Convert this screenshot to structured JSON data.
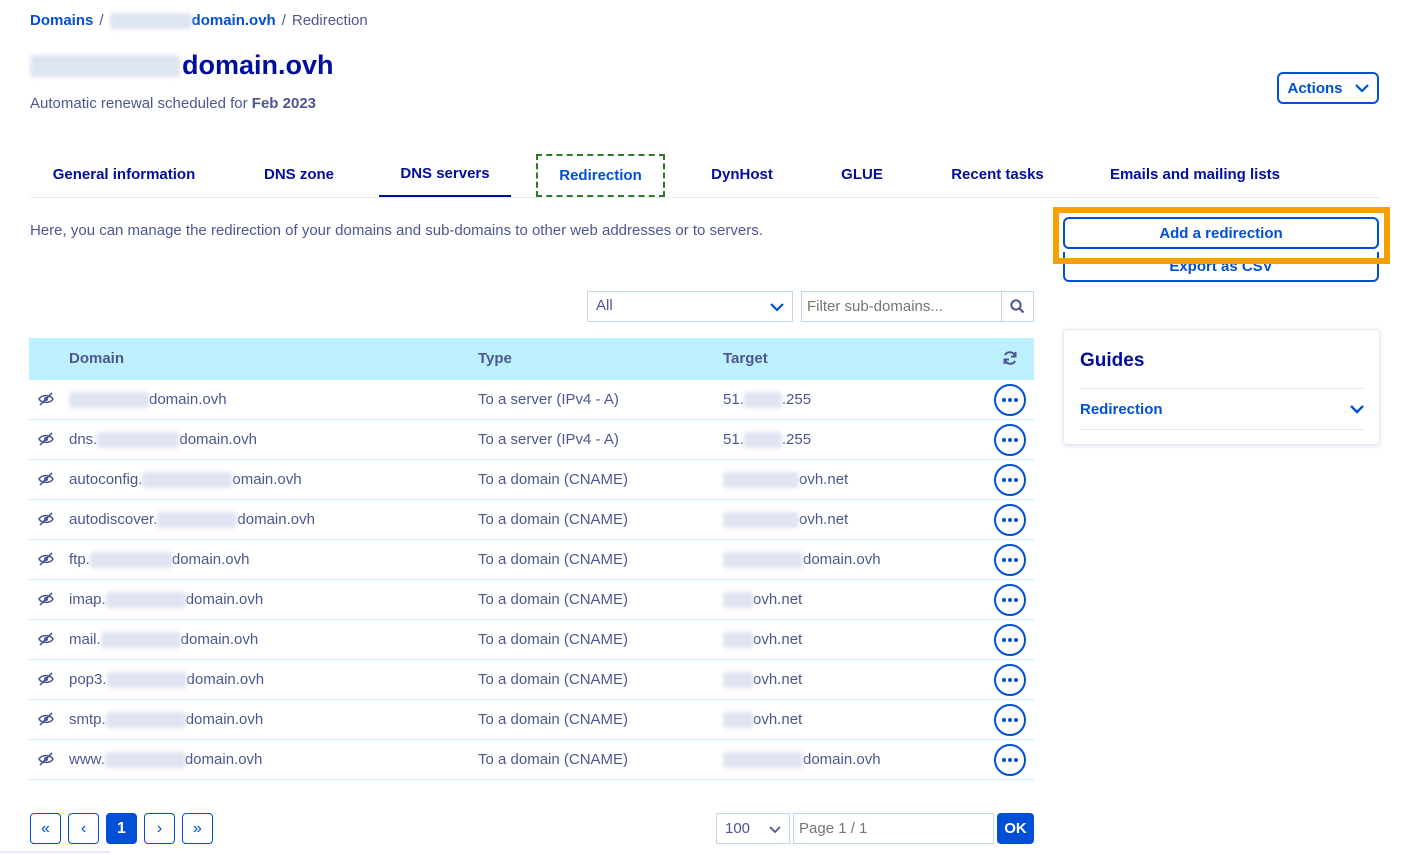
{
  "breadcrumb": {
    "root": "Domains",
    "sep1": "/",
    "domain": "domain.ovh",
    "sep2": "/",
    "current": "Redirection"
  },
  "header": {
    "title": "domain.ovh",
    "renewal_prefix": "Automatic renewal scheduled for ",
    "renewal_date": "Feb 2023",
    "actions_label": "Actions"
  },
  "tabs": [
    {
      "label": "General information"
    },
    {
      "label": "DNS zone"
    },
    {
      "label": "DNS servers"
    },
    {
      "label": "Redirection"
    },
    {
      "label": "DynHost"
    },
    {
      "label": "GLUE"
    },
    {
      "label": "Recent tasks"
    },
    {
      "label": "Emails and mailing lists"
    }
  ],
  "intro": "Here, you can manage the redirection of your domains and sub-domains to other web addresses or to servers.",
  "side": {
    "add_label": "Add a redirection",
    "export_label": "Export as CSV",
    "guides_title": "Guides",
    "guide_item": "Redirection"
  },
  "filters": {
    "type_value": "All",
    "search_placeholder": "Filter sub-domains..."
  },
  "table": {
    "headers": {
      "domain": "Domain",
      "type": "Type",
      "target": "Target"
    },
    "rows": [
      {
        "domain_prefix": "",
        "domain_suffix": "domain.ovh",
        "type": "To a server (IPv4 - A)",
        "target_prefix": "51.",
        "target_suffix": ".255"
      },
      {
        "domain_prefix": "dns.",
        "domain_suffix": "domain.ovh",
        "type": "To a server (IPv4 - A)",
        "target_prefix": "51.",
        "target_suffix": ".255"
      },
      {
        "domain_prefix": "autoconfig.",
        "domain_suffix": "omain.ovh",
        "type": "To a domain (CNAME)",
        "target_prefix": "",
        "target_suffix": "ovh.net"
      },
      {
        "domain_prefix": "autodiscover.",
        "domain_suffix": "domain.ovh",
        "type": "To a domain (CNAME)",
        "target_prefix": "",
        "target_suffix": "ovh.net"
      },
      {
        "domain_prefix": "ftp.",
        "domain_suffix": "domain.ovh",
        "type": "To a domain (CNAME)",
        "target_prefix": "",
        "target_suffix": "domain.ovh"
      },
      {
        "domain_prefix": "imap.",
        "domain_suffix": "domain.ovh",
        "type": "To a domain (CNAME)",
        "target_prefix": "",
        "target_suffix": "ovh.net"
      },
      {
        "domain_prefix": "mail.",
        "domain_suffix": "domain.ovh",
        "type": "To a domain (CNAME)",
        "target_prefix": "",
        "target_suffix": "ovh.net"
      },
      {
        "domain_prefix": "pop3.",
        "domain_suffix": "domain.ovh",
        "type": "To a domain (CNAME)",
        "target_prefix": "",
        "target_suffix": "ovh.net"
      },
      {
        "domain_prefix": "smtp.",
        "domain_suffix": "domain.ovh",
        "type": "To a domain (CNAME)",
        "target_prefix": "",
        "target_suffix": "ovh.net"
      },
      {
        "domain_prefix": "www.",
        "domain_suffix": "domain.ovh",
        "type": "To a domain (CNAME)",
        "target_prefix": "",
        "target_suffix": "domain.ovh"
      }
    ]
  },
  "pagination": {
    "first": "«",
    "prev": "‹",
    "current": "1",
    "next": "›",
    "last": "»",
    "per_page": "100",
    "page_placeholder": "Page 1 / 1",
    "ok_label": "OK"
  },
  "icons": {
    "chevron": "chevron-down-icon",
    "search": "search-icon",
    "refresh": "refresh-icon",
    "eye": "eye-slash-icon",
    "more": "more-options-icon"
  },
  "colors": {
    "primary": "#0050d7",
    "heading": "#000e9c",
    "text": "#4d5693",
    "table_header": "#bef1ff",
    "highlight": "#f7a000"
  }
}
